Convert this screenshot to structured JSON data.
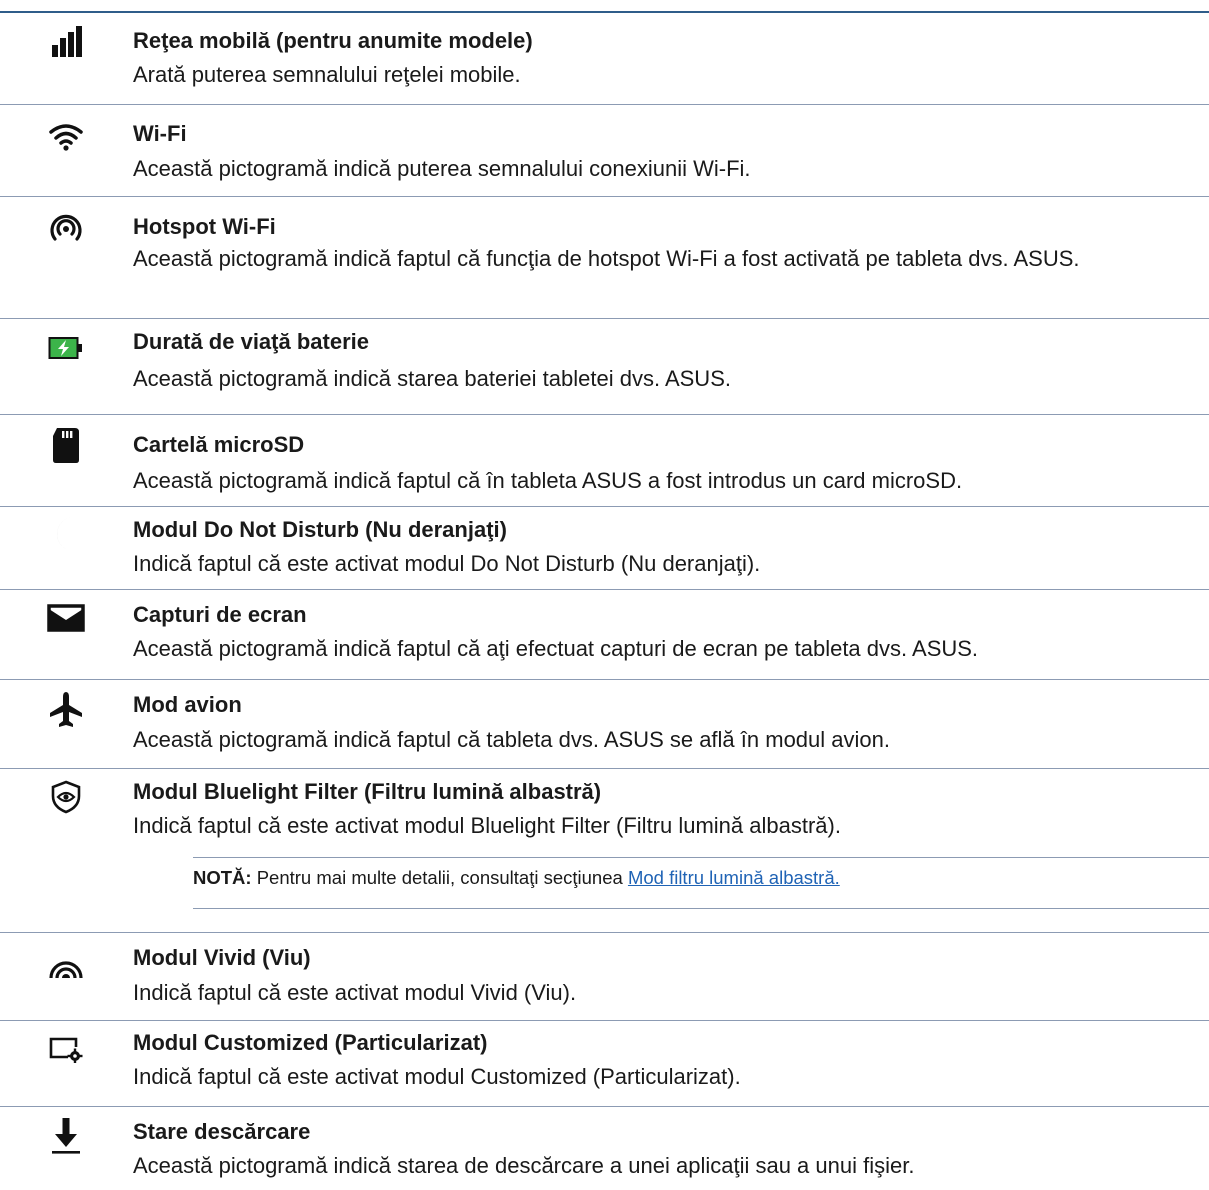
{
  "items": [
    {
      "icon": "signal-bars-icon",
      "title": "Reţea mobilă (pentru anumite modele)",
      "desc": "Arată puterea semnalului reţelei mobile."
    },
    {
      "icon": "wifi-icon",
      "title": "Wi-Fi",
      "desc": "Această pictogramă indică puterea semnalului conexiunii Wi-Fi."
    },
    {
      "icon": "hotspot-icon",
      "title": "Hotspot Wi-Fi",
      "desc": "Această pictogramă indică faptul că funcţia de hotspot Wi-Fi a fost activată pe tableta dvs. ASUS."
    },
    {
      "icon": "battery-charging-icon",
      "title": "Durată de viaţă baterie",
      "desc": "Această pictogramă indică starea bateriei tabletei dvs. ASUS."
    },
    {
      "icon": "microsd-card-icon",
      "title": "Cartelă microSD",
      "desc": "Această pictogramă indică faptul că în tableta ASUS a fost introdus un card microSD."
    },
    {
      "icon": "moon-icon",
      "title": "Modul Do Not Disturb (Nu deranjaţi)",
      "desc": "Indică faptul că este activat modul Do Not Disturb (Nu deranjaţi)."
    },
    {
      "icon": "screenshot-icon",
      "title": "Capturi de ecran",
      "desc": "Această pictogramă indică faptul că aţi efectuat capturi de ecran pe tableta dvs. ASUS."
    },
    {
      "icon": "airplane-icon",
      "title": "Mod avion",
      "desc": "Această pictogramă indică faptul că tableta dvs. ASUS se află în modul avion."
    },
    {
      "icon": "bluelight-filter-icon",
      "title": "Modul Bluelight Filter (Filtru lumină albastră)",
      "desc": "Indică faptul că este activat modul Bluelight Filter (Filtru lumină albastră)."
    },
    {
      "icon": "vivid-mode-icon",
      "title": "Modul Vivid (Viu)",
      "desc": "Indică faptul că este activat modul Vivid (Viu)."
    },
    {
      "icon": "customized-mode-icon",
      "title": "Modul Customized (Particularizat)",
      "desc": "Indică faptul că este activat modul Customized (Particularizat)."
    },
    {
      "icon": "download-icon",
      "title": "Stare descărcare",
      "desc": "Această pictogramă indică starea de descărcare a unei aplicaţii sau a unui fişier."
    }
  ],
  "note": {
    "label": "NOTĂ:",
    "text": " Pentru mai multe detalii, consultaţi secţiunea ",
    "link": "Mod filtru lumină albastră."
  },
  "colors": {
    "rule": "#2f5d8a",
    "separator": "#8c9bb3",
    "link": "#1f63b5",
    "battery": "#3cb44a"
  }
}
